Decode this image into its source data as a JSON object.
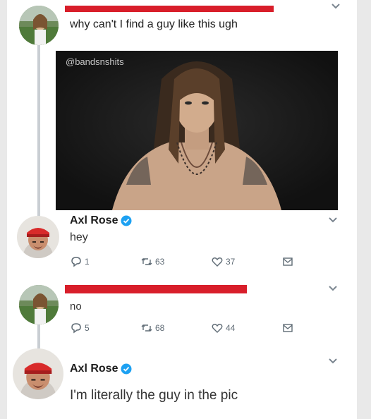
{
  "colors": {
    "redaction": "#d81e2a",
    "verified": "#1da1f2",
    "muted": "#5f6b75",
    "thread_line": "#c9ced3"
  },
  "tweet1": {
    "text": "why can't I find a guy like this ugh",
    "image_watermark": "@bandsnshits",
    "avatar_icon": "avatar-woman-field",
    "chevron_icon": "chevron-down-icon"
  },
  "reply1": {
    "name": "Axl Rose",
    "verified_icon": "verified-badge-icon",
    "text": "hey",
    "replies": "1",
    "retweets": "63",
    "likes": "37",
    "avatar_icon": "avatar-red-bandana"
  },
  "reply2": {
    "text": "no",
    "replies": "5",
    "retweets": "68",
    "likes": "44",
    "avatar_icon": "avatar-woman-field"
  },
  "reply3": {
    "name": "Axl Rose",
    "verified_icon": "verified-badge-icon",
    "text": "I'm literally the guy in the pic",
    "avatar_icon": "avatar-red-bandana"
  },
  "icons": {
    "reply": "reply-icon",
    "retweet": "retweet-icon",
    "like": "heart-icon",
    "message": "message-icon"
  }
}
